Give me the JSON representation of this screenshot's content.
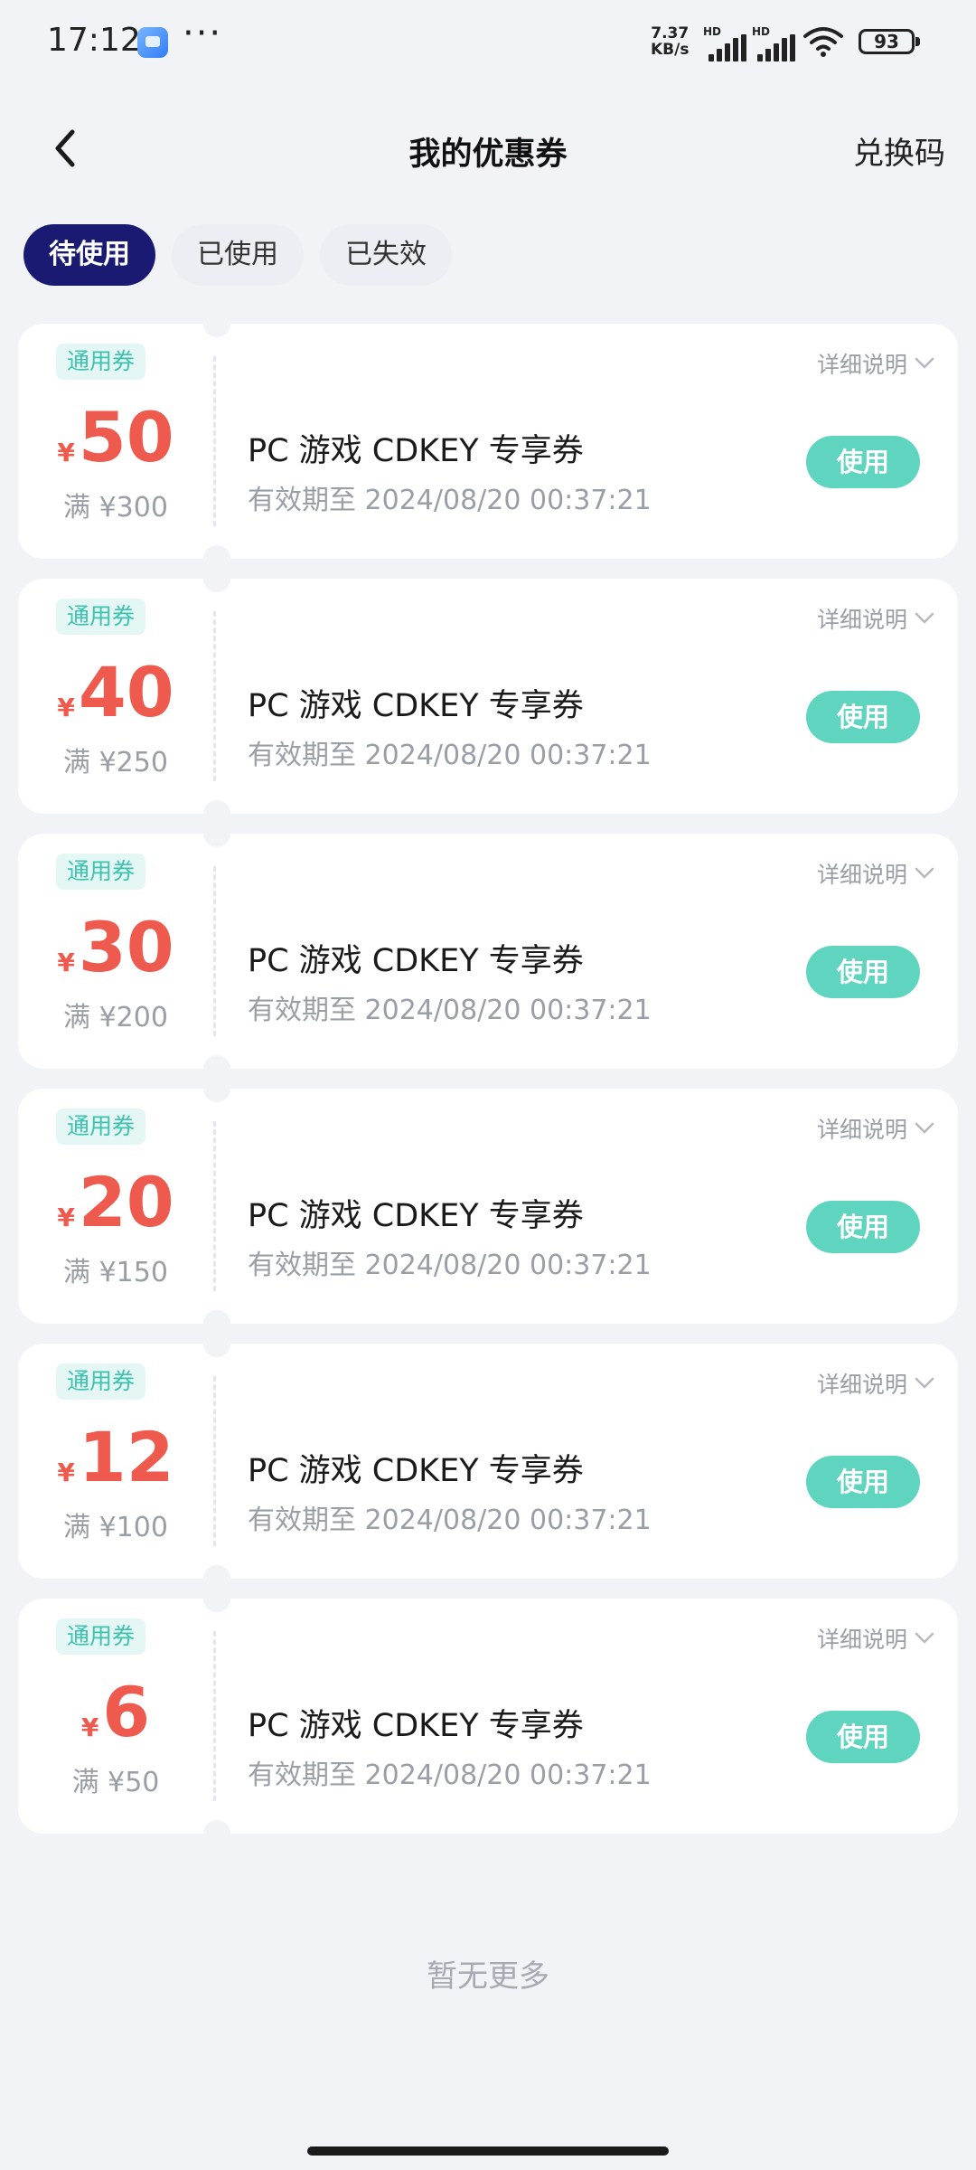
{
  "status_bar": {
    "time": "17:12",
    "app_icon": "app-icon",
    "more": "···",
    "speed_value": "7.37",
    "speed_unit": "KB/s",
    "hd_label": "HD",
    "battery": "93"
  },
  "header": {
    "back_icon": "chevron-left-icon",
    "title": "我的优惠券",
    "redeem": "兑换码"
  },
  "tabs": [
    {
      "label": "待使用",
      "active": true
    },
    {
      "label": "已使用",
      "active": false
    },
    {
      "label": "已失效",
      "active": false
    }
  ],
  "coupons": [
    {
      "tag": "通用券",
      "currency": "¥",
      "amount": "50",
      "threshold": "满 ¥300",
      "title": "PC 游戏 CDKEY 专享券",
      "expiry": "有效期至 2024/08/20 00:37:21",
      "details": "详细说明",
      "use": "使用"
    },
    {
      "tag": "通用券",
      "currency": "¥",
      "amount": "40",
      "threshold": "满 ¥250",
      "title": "PC 游戏 CDKEY 专享券",
      "expiry": "有效期至 2024/08/20 00:37:21",
      "details": "详细说明",
      "use": "使用"
    },
    {
      "tag": "通用券",
      "currency": "¥",
      "amount": "30",
      "threshold": "满 ¥200",
      "title": "PC 游戏 CDKEY 专享券",
      "expiry": "有效期至 2024/08/20 00:37:21",
      "details": "详细说明",
      "use": "使用"
    },
    {
      "tag": "通用券",
      "currency": "¥",
      "amount": "20",
      "threshold": "满 ¥150",
      "title": "PC 游戏 CDKEY 专享券",
      "expiry": "有效期至 2024/08/20 00:37:21",
      "details": "详细说明",
      "use": "使用"
    },
    {
      "tag": "通用券",
      "currency": "¥",
      "amount": "12",
      "threshold": "满 ¥100",
      "title": "PC 游戏 CDKEY 专享券",
      "expiry": "有效期至 2024/08/20 00:37:21",
      "details": "详细说明",
      "use": "使用"
    },
    {
      "tag": "通用券",
      "currency": "¥",
      "amount": "6",
      "threshold": "满 ¥50",
      "title": "PC 游戏 CDKEY 专享券",
      "expiry": "有效期至 2024/08/20 00:37:21",
      "details": "详细说明",
      "use": "使用"
    }
  ],
  "footer": {
    "no_more": "暂无更多"
  },
  "colors": {
    "accent_dark": "#1a1a73",
    "amount_red": "#ee5a4e",
    "use_teal": "#5fd5c0",
    "tag_text": "#3cc2ae",
    "tag_bg": "#e5f7f4",
    "background": "#f2f3f7"
  }
}
